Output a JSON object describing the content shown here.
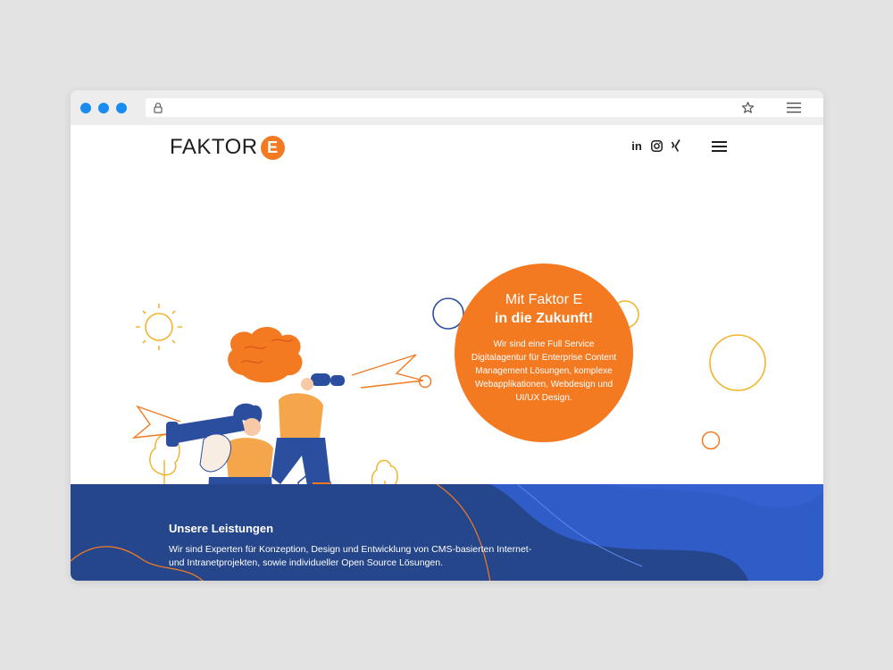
{
  "browser": {
    "window_controls": [
      "close",
      "minimize",
      "maximize"
    ],
    "lock_icon": "lock-icon",
    "bookmark_icon": "star-icon",
    "menu_icon": "menu-icon"
  },
  "header": {
    "logo_text": "FAKTOR",
    "logo_mark": "E",
    "social": [
      {
        "name": "linkedin",
        "label": "in"
      },
      {
        "name": "instagram",
        "icon": "instagram-icon"
      },
      {
        "name": "xing",
        "icon": "xing-icon"
      }
    ],
    "menu_icon": "hamburger-icon"
  },
  "hero": {
    "title": "Mit Faktor E",
    "subtitle": "in die Zukunft!",
    "body": "Wir sind eine Full Service Digitalagentur für Enterprise Content Management Lösungen, komplexe Webapplikationen, Webdesign und UI/UX Design."
  },
  "services": {
    "title": "Unsere Leistungen",
    "text": "Wir sind Experten für Konzeption, Design und Entwicklung von CMS-basierten Internet- und Intranetprojekten, sowie individueller Open Source Lösungen."
  },
  "colors": {
    "accent": "#f47a22",
    "navy": "#25468a",
    "blue": "#2f5cc7",
    "yellow": "#f1b52e",
    "dark": "#1e1e1e",
    "browser_dot": "#1a8cf0"
  }
}
